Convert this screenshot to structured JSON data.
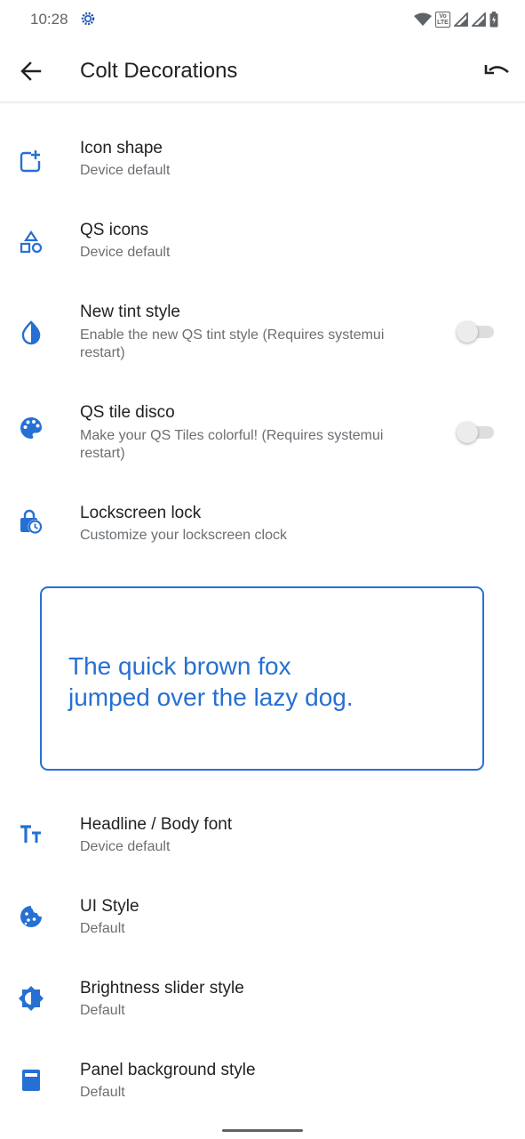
{
  "status_bar": {
    "time": "10:28",
    "volte": "Vo LTE"
  },
  "app_bar": {
    "title": "Colt Decorations"
  },
  "colors": {
    "accent": "#2670d3",
    "text_primary": "#202124",
    "text_secondary": "#6b6f73"
  },
  "settings": [
    {
      "title": "Icon shape",
      "summary": "Device default",
      "icon": "icon-shape-icon"
    },
    {
      "title": "QS icons",
      "summary": "Device default",
      "icon": "shapes-icon"
    },
    {
      "title": "New tint style",
      "summary": "Enable the new QS tint style (Requires systemui restart)",
      "icon": "contrast-drop-icon",
      "toggle": false
    },
    {
      "title": "QS tile disco",
      "summary": "Make your QS Tiles colorful! (Requires systemui restart)",
      "icon": "palette-icon",
      "toggle": false
    },
    {
      "title": "Lockscreen lock",
      "summary": "Customize your lockscreen clock",
      "icon": "lock-clock-icon"
    }
  ],
  "font_preview": {
    "line1": "The quick brown fox",
    "line2": "jumped over the lazy dog."
  },
  "settings2": [
    {
      "title": "Headline / Body font",
      "summary": "Device default",
      "icon": "text-fields-icon"
    },
    {
      "title": "UI Style",
      "summary": "Default",
      "icon": "cookie-icon"
    },
    {
      "title": "Brightness slider style",
      "summary": "Default",
      "icon": "brightness-icon"
    },
    {
      "title": "Panel background style",
      "summary": "Default",
      "icon": "panel-icon"
    }
  ]
}
